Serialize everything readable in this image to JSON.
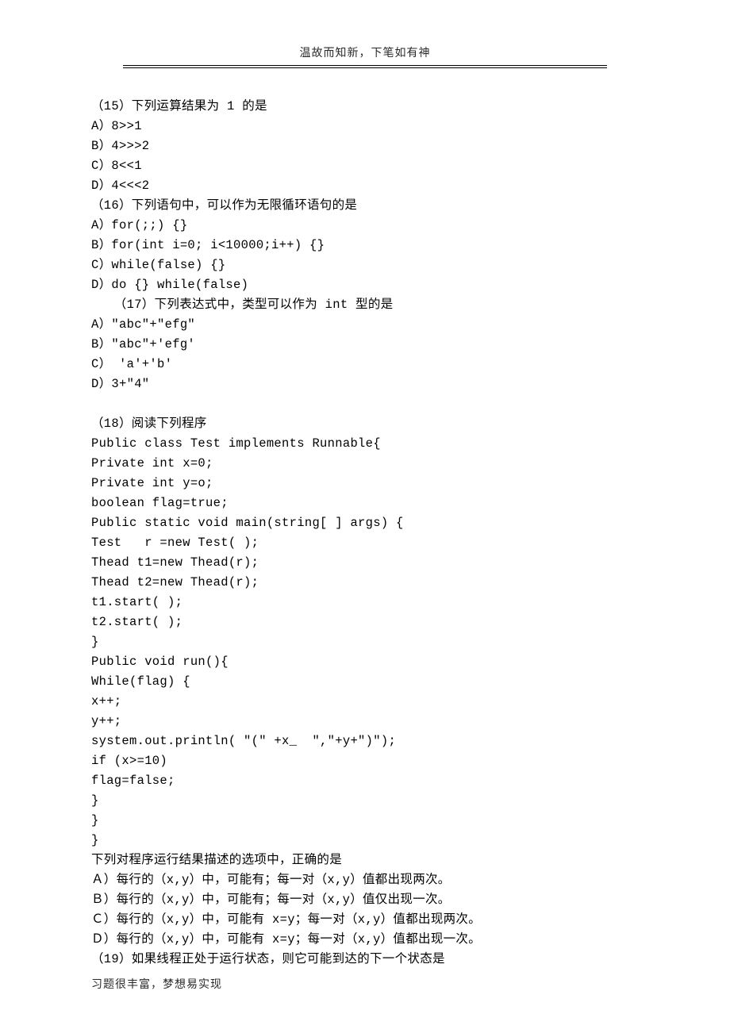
{
  "header": "温故而知新，下笔如有神",
  "footer": "习题很丰富，梦想易实现",
  "lines": [
    "（15）下列运算结果为 1 的是",
    "A）8>>1",
    "B）4>>>2",
    "C）8<<1",
    "D）4<<<2",
    "（16）下列语句中，可以作为无限循环语句的是",
    "A）for(;;) {}",
    "B）for(int i=0; i<10000;i++) {}",
    "C）while(false) {}",
    "D）do {} while(false)",
    "   （17）下列表达式中，类型可以作为 int 型的是",
    "A）\"abc\"+\"efg\"",
    "B）\"abc\"+'efg'",
    "C） 'a'+'b'",
    "D）3+\"4\"",
    "",
    "（18）阅读下列程序",
    "Public class Test implements Runnable{",
    "Private int x=0;",
    "Private int y=o;",
    "boolean flag=true;",
    "Public static void main(string[ ] args) {",
    "Test   r =new Test( );",
    "Thead t1=new Thead(r);",
    "Thead t2=new Thead(r);",
    "t1.start( );",
    "t2.start( );",
    "}",
    "Public void run(){",
    "While(flag) {",
    "x++;",
    "y++;",
    "system.out.println( \"(\" +x_  \",\"+y+\")\");",
    "if (x>=10)",
    "flag=false;",
    "}",
    "}",
    "}",
    "下列对程序运行结果描述的选项中，正确的是",
    "Ａ）每行的（x,y）中，可能有；每一对（x,y）值都出现两次。",
    "Ｂ）每行的（x,y）中，可能有；每一对（x,y）值仅出现一次。",
    "Ｃ）每行的（x,y）中，可能有 x=y；每一对（x,y）值都出现两次。",
    "Ｄ）每行的（x,y）中，可能有 x=y；每一对（x,y）值都出现一次。",
    "（19）如果线程正处于运行状态，则它可能到达的下一个状态是"
  ]
}
